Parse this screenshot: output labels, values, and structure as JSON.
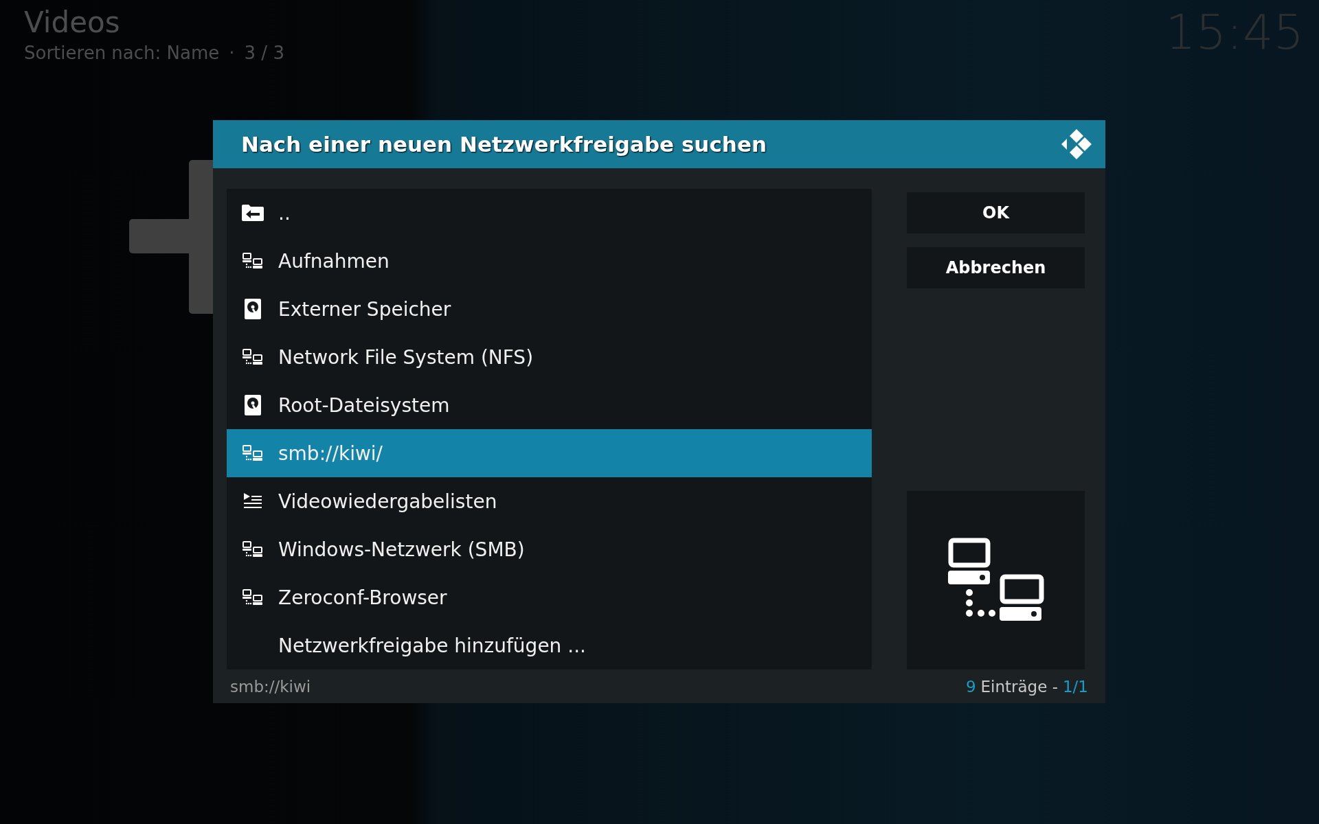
{
  "header": {
    "title": "Videos",
    "sort_label": "Sortieren nach: Name",
    "separator": "·",
    "position": "3 / 3"
  },
  "clock": "15:45",
  "dialog": {
    "title": "Nach einer neuen Netzwerkfreigabe suchen",
    "items": [
      {
        "kind": "parent",
        "label": "..",
        "selected": false
      },
      {
        "kind": "network",
        "label": "Aufnahmen",
        "selected": false
      },
      {
        "kind": "drive",
        "label": "Externer Speicher",
        "selected": false
      },
      {
        "kind": "network",
        "label": "Network File System (NFS)",
        "selected": false
      },
      {
        "kind": "drive",
        "label": "Root-Dateisystem",
        "selected": false
      },
      {
        "kind": "network",
        "label": "smb://kiwi/",
        "selected": true
      },
      {
        "kind": "playlist",
        "label": "Videowiedergabelisten",
        "selected": false
      },
      {
        "kind": "network",
        "label": "Windows-Netzwerk (SMB)",
        "selected": false
      },
      {
        "kind": "network",
        "label": "Zeroconf-Browser",
        "selected": false
      },
      {
        "kind": "add",
        "label": "Netzwerkfreigabe hinzufügen ...",
        "selected": false
      }
    ],
    "buttons": [
      {
        "label": "OK"
      },
      {
        "label": "Abbrechen"
      }
    ],
    "path": "smb://kiwi",
    "count": "9",
    "count_label": "Einträge -",
    "page": "1/1"
  }
}
